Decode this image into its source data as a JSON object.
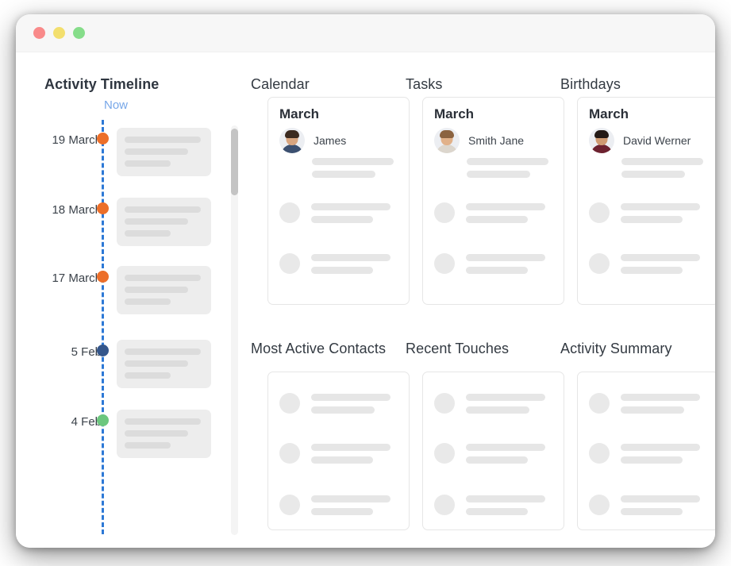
{
  "window": {
    "traffic_lights": [
      {
        "name": "close",
        "color": "#f98a8a"
      },
      {
        "name": "minimize",
        "color": "#f3df6e"
      },
      {
        "name": "zoom",
        "color": "#86dd8a"
      }
    ]
  },
  "headings": {
    "activity_timeline": "Activity Timeline",
    "calendar": "Calendar",
    "tasks": "Tasks",
    "birthdays": "Birthdays",
    "most_active_contacts": "Most Active Contacts",
    "recent_touches": "Recent Touches",
    "activity_summary": "Activity Summary"
  },
  "timeline": {
    "now_label": "Now",
    "now_line_color": "#2d79d6",
    "now_label_color": "#77a7e8",
    "entries": [
      {
        "date": "19 March",
        "dot_color": "#ec6f2a"
      },
      {
        "date": "18 March",
        "dot_color": "#ec6f2a"
      },
      {
        "date": "17 March",
        "dot_color": "#ec6f2a"
      },
      {
        "date": "5 Feb",
        "dot_color": "#34568b"
      },
      {
        "date": "4 Feb",
        "dot_color": "#6cc77e"
      }
    ]
  },
  "scrollbar": {
    "name": "timeline-scrollbar",
    "track_color": "#f4f4f4",
    "thumb_color": "#c4c4c4"
  },
  "top_cards": [
    {
      "key": "calendar",
      "title": "March",
      "person": "James",
      "avatar": {
        "skin": "#d8a57f",
        "hair": "#3c2b20",
        "shirt": "#3c5070"
      }
    },
    {
      "key": "tasks",
      "title": "March",
      "person": "Smith Jane",
      "avatar": {
        "skin": "#e1b189",
        "hair": "#8b6340",
        "shirt": "#dcd6cd"
      }
    },
    {
      "key": "birthdays",
      "title": "March",
      "person": "David Werner",
      "avatar": {
        "skin": "#cf9a72",
        "hair": "#241a16",
        "shirt": "#6d2230"
      }
    }
  ],
  "bottom_cards": [
    {
      "key": "most-active-contacts",
      "rows": 3
    },
    {
      "key": "recent-touches",
      "rows": 3
    },
    {
      "key": "activity-summary",
      "rows": 3
    }
  ]
}
